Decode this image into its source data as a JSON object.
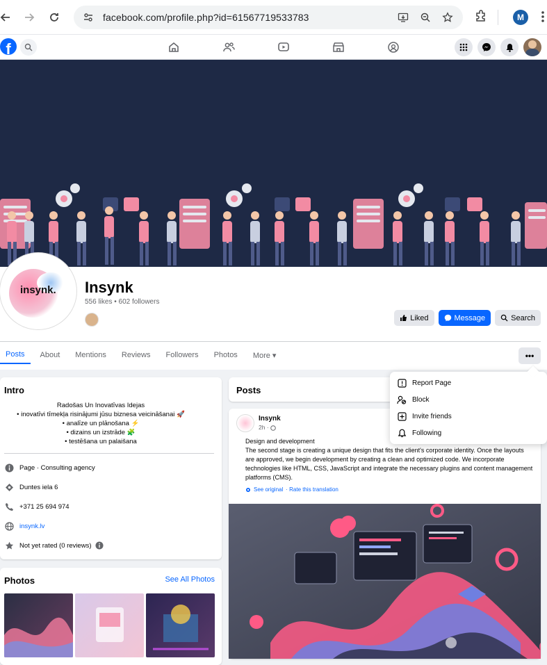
{
  "browser": {
    "url": "facebook.com/profile.php?id=61567719533783",
    "profile_initial": "M"
  },
  "fb_header": {
    "logo_letter": "f"
  },
  "profile": {
    "name": "Insynk",
    "logo_text": "insynk.",
    "stats": "556 likes • 602 followers",
    "buttons": {
      "liked": "Liked",
      "message": "Message",
      "search": "Search"
    },
    "tabs": [
      "Posts",
      "About",
      "Mentions",
      "Reviews",
      "Followers",
      "Photos",
      "More ▾"
    ],
    "more_dots": "•••"
  },
  "intro": {
    "title": "Intro",
    "bio": [
      "Radošas Un Inovatīvas Idejas",
      "• inovatīvi tīmekļa risinājumi jūsu biznesa veicināšanai 🚀",
      "• analīze un plānošana ⚡",
      "• dizains un izstrāde 🧩",
      "• testēšana un palaišana"
    ],
    "page_type": "Page · Consulting agency",
    "address": "Duntes iela 6",
    "phone": "+371 25 694 974",
    "website": "insynk.lv",
    "rating": "Not yet rated (0 reviews)"
  },
  "photos": {
    "title": "Photos",
    "see_all": "See All Photos"
  },
  "posts": {
    "title": "Posts",
    "post": {
      "author": "Insynk",
      "time": "2h ·",
      "text_title": "Design and development",
      "text_body": "The second stage is creating a unique design that fits the client's corporate identity. Once the layouts are approved, we begin development by creating a clean and optimized code. We incorporate technologies like HTML, CSS, JavaScript and integrate the necessary plugins and content management platforms (CMS).",
      "see_original": "See original",
      "rate": "· Rate this translation"
    }
  },
  "menu": {
    "items": [
      "Report Page",
      "Block",
      "Invite friends",
      "Following"
    ]
  },
  "colors": {
    "fb_blue": "#0866ff",
    "cover_bg": "#1e2945"
  }
}
